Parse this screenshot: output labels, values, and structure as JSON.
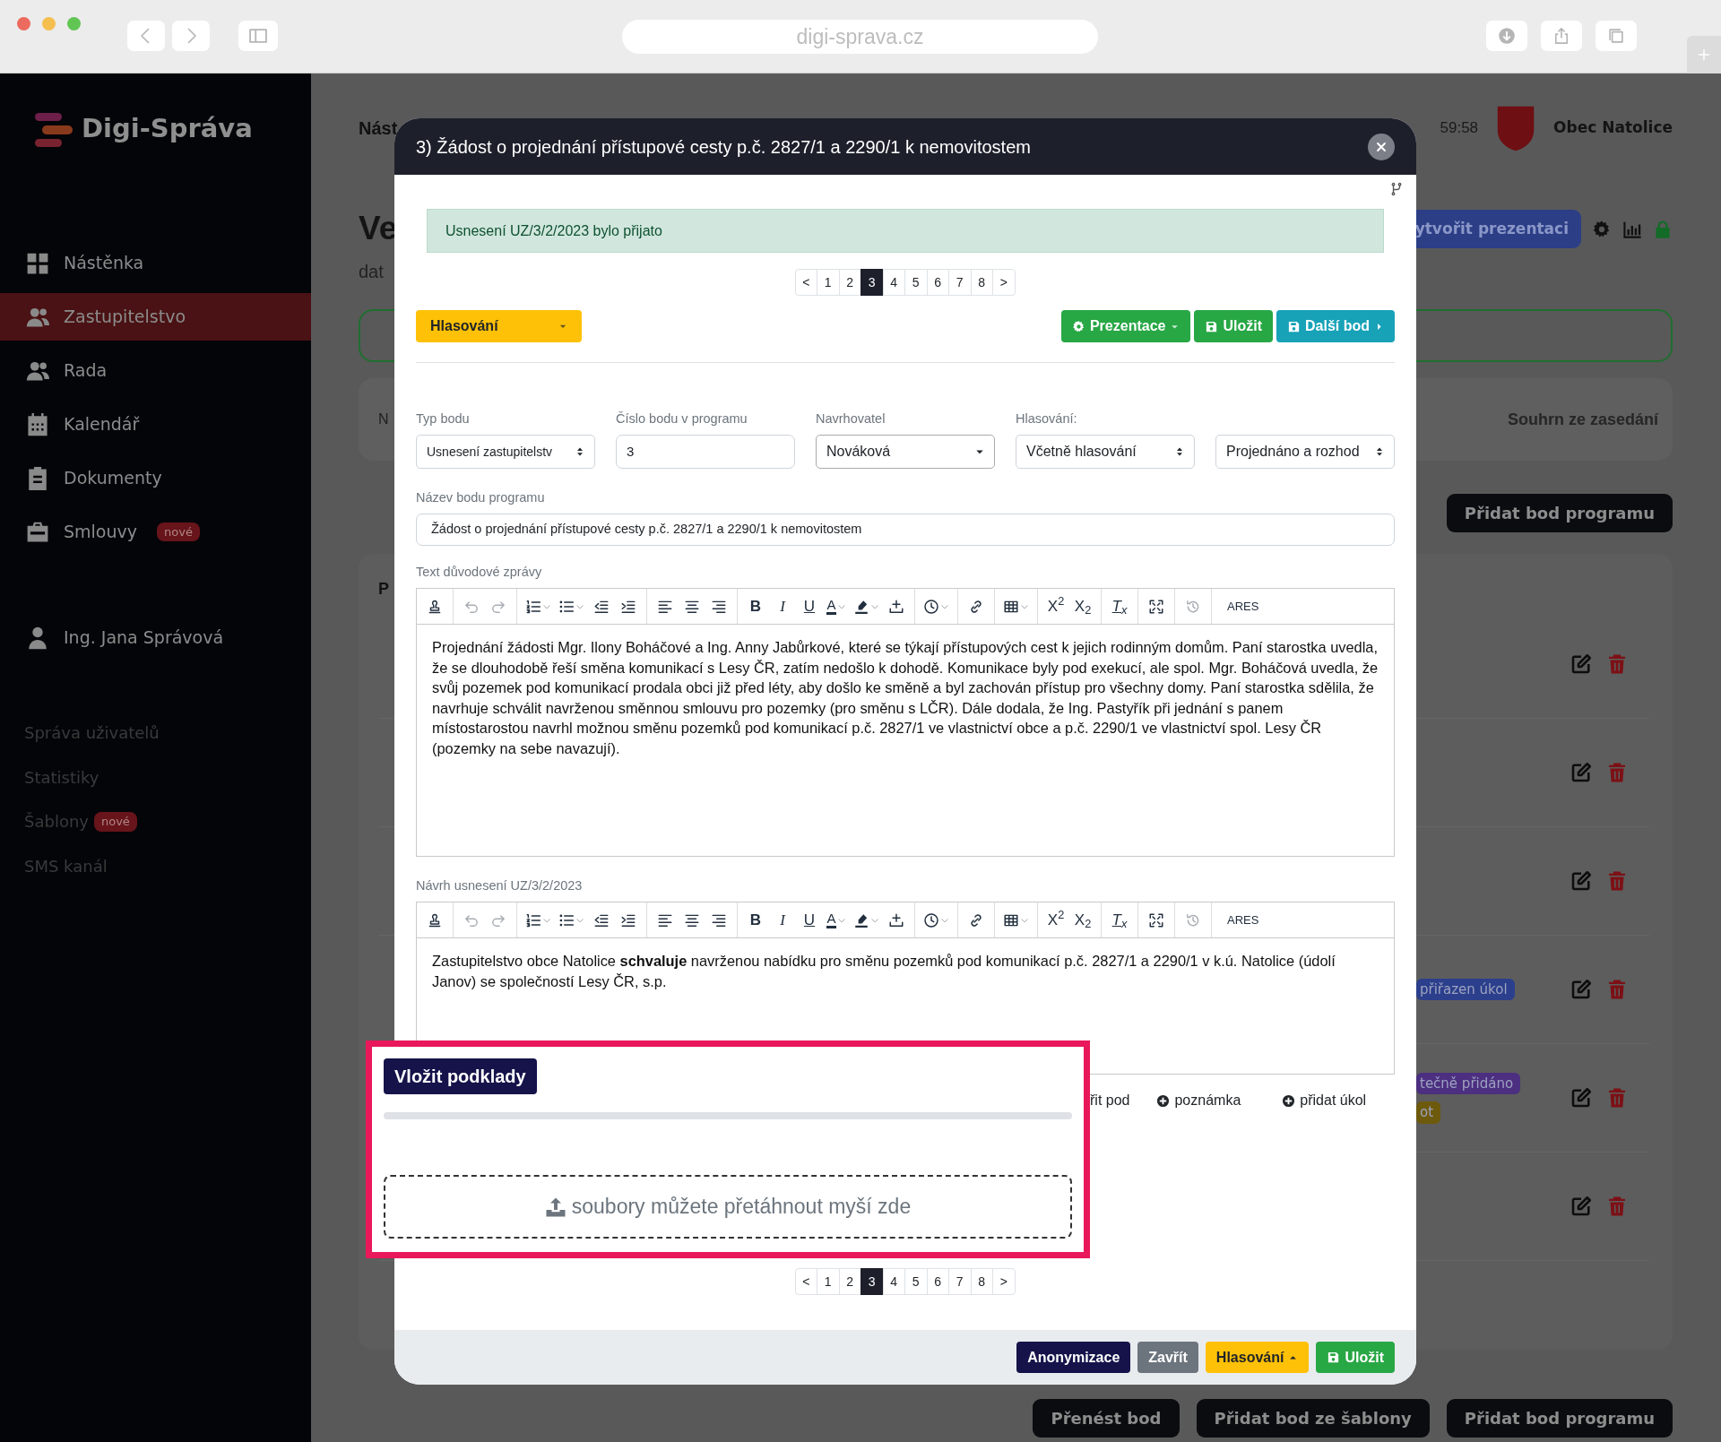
{
  "browser": {
    "url": "digi-sprava.cz"
  },
  "sidebar": {
    "brand": "Digi-Správa",
    "nav": [
      {
        "label": "Nástěnka",
        "kind": "grid",
        "selected": false
      },
      {
        "label": "Zastupitelstvo",
        "kind": "users",
        "selected": true
      },
      {
        "label": "Rada",
        "kind": "users",
        "selected": false
      },
      {
        "label": "Kalendář",
        "kind": "calendar",
        "selected": false
      },
      {
        "label": "Dokumenty",
        "kind": "clipboard",
        "selected": false
      },
      {
        "label": "Smlouvy",
        "kind": "briefcase",
        "selected": false,
        "badge": "nové"
      }
    ],
    "user": "Ing. Jana Správová",
    "admin_links": [
      {
        "label": "Správa uživatelů"
      },
      {
        "label": "Statistiky"
      },
      {
        "label": "Šablony",
        "badge": "nové"
      },
      {
        "label": "SMS kanál"
      }
    ]
  },
  "page": {
    "breadcrumb": "Nást",
    "time": "59:58",
    "municipality": "Obec Natolice",
    "heading": "Ve",
    "subheading": "dat",
    "create_button": "ytvořit prezentaci",
    "summary_left": "N",
    "summary_right": "Souhrn ze zasedání",
    "add_button_top": "Přidat bod programu",
    "list_heading": "P",
    "rows": [
      {},
      {},
      {},
      {
        "badges": [
          {
            "label": "přiřazen úkol",
            "color": "#2b3f8c"
          }
        ]
      },
      {
        "badges": [
          {
            "label": "tečně přidáno",
            "color": "#4c2f80"
          },
          {
            "label": "ot",
            "color": "#6e5a0c"
          }
        ]
      },
      {}
    ],
    "bottom_buttons": [
      "Přenést bod",
      "Přidat bod ze šablony",
      "Přidat bod programu"
    ]
  },
  "modal": {
    "title": "3) Žádost o projednání přístupové cesty p.č. 2827/1 a 2290/1 k nemovitostem",
    "alert": "Usnesení UZ/3/2/2023 bylo přijato",
    "pagination_top": [
      {
        "label": "<",
        "selected": false
      },
      {
        "label": "1",
        "selected": false
      },
      {
        "label": "2",
        "selected": false
      },
      {
        "label": "3",
        "selected": true
      },
      {
        "label": "4",
        "selected": false
      },
      {
        "label": "5",
        "selected": false
      },
      {
        "label": "6",
        "selected": false
      },
      {
        "label": "7",
        "selected": false
      },
      {
        "label": "8",
        "selected": false
      },
      {
        "label": ">",
        "selected": false
      }
    ],
    "voting_dropdown": "Hlasování",
    "actions": [
      {
        "label": "Prezentace"
      },
      {
        "label": "Uložit"
      },
      {
        "label": "Další bod"
      }
    ],
    "fields": [
      {
        "label": "Typ bodu",
        "value": "Usnesení zastupitelstv",
        "kind": "select"
      },
      {
        "label": "Číslo bodu v programu",
        "value": "3",
        "kind": "input"
      },
      {
        "label": "Navrhovatel",
        "value": "Nováková",
        "kind": "dropdown"
      },
      {
        "label": "Hlasování:",
        "value": "Včetně hlasování",
        "kind": "select"
      },
      {
        "value": "Projednáno a rozhod",
        "kind": "select"
      }
    ],
    "name_field": {
      "label": "Název bodu programu",
      "value": "Žádost o projednání přístupové cesty p.č. 2827/1 a 2290/1 k nemovitostem"
    },
    "editors": [
      {
        "label": "Text důvodové zprávy",
        "text": "Projednání žádosti Mgr. Ilony Boháčové a Ing. Anny Jabůrkové, které se týkají přístupových cest k jejich rodinným domům. Paní starostka uvedla, že se dlouhodobě řeší směna komunikací s Lesy ČR, zatím nedošlo k dohodě. Komunikace byly pod exekucí, ale spol. Mgr. Boháčová uvedla, že svůj pozemek pod komunikací prodala obci již před léty, aby došlo ke směně a byl zachován přístup pro všechny domy. Paní starostka sdělila, že navrhuje schválit navrženou směnnou smlouvu pro pozemky (pro směnu s LČR). Dále dodala, že Ing. Pastyřík při jednání s panem místostarostou navrhl možnou směnu pozemků pod komunikací p.č. 2827/1 ve vlastnictví obce a p.č. 2290/1 ve vlastnictví spol. Lesy ČR (pozemky na sebe navazují).",
        "toolbar": [
          [
            {
              "kind": "stamp"
            }
          ],
          [
            {
              "kind": "undo",
              "disabled": true
            },
            {
              "kind": "redo",
              "disabled": true
            }
          ],
          [
            {
              "kind": "ordered-list",
              "dropdown": true
            },
            {
              "kind": "bullet-list",
              "dropdown": true
            },
            {
              "kind": "outdent"
            },
            {
              "kind": "indent"
            }
          ],
          [
            {
              "kind": "align-left"
            },
            {
              "kind": "align-center"
            },
            {
              "kind": "align-right"
            }
          ],
          [
            {
              "kind": "bold",
              "label": "B"
            },
            {
              "kind": "italic",
              "label": "I"
            },
            {
              "kind": "underline",
              "label": "U"
            },
            {
              "kind": "text-color",
              "label": "A",
              "dropdown": true
            },
            {
              "kind": "highlight",
              "dropdown": true
            },
            {
              "kind": "insert"
            }
          ],
          [
            {
              "kind": "clock",
              "dropdown": true
            }
          ],
          [
            {
              "kind": "link"
            }
          ],
          [
            {
              "kind": "table",
              "dropdown": true
            }
          ],
          [
            {
              "kind": "superscript",
              "label": "X$^{2}$"
            },
            {
              "kind": "subscript",
              "label": "X$_{2}$"
            }
          ],
          [
            {
              "kind": "clear-format",
              "label": "T$_{x}$"
            }
          ],
          [
            {
              "kind": "fullscreen"
            }
          ],
          [
            {
              "kind": "history",
              "disabled": true
            }
          ],
          [
            {
              "kind": "plain",
              "label": "ARES"
            }
          ]
        ]
      },
      {
        "label": "Návrh usnesení UZ/3/2/2023",
        "text": "Zastupitelstvo obce Natolice **schvaluje** navrženou nabídku pro směnu pozemků pod komunikací p.č. 2827/1 a 2290/1 v k.ú. Natolice (údolí Janov) se společností Lesy ČR, s.p.",
        "toolbar": [
          [
            {
              "kind": "stamp"
            }
          ],
          [
            {
              "kind": "undo",
              "disabled": true
            },
            {
              "kind": "redo",
              "disabled": true
            }
          ],
          [
            {
              "kind": "ordered-list",
              "dropdown": true
            },
            {
              "kind": "bullet-list",
              "dropdown": true
            },
            {
              "kind": "outdent"
            },
            {
              "kind": "indent"
            }
          ],
          [
            {
              "kind": "align-left"
            },
            {
              "kind": "align-center"
            },
            {
              "kind": "align-right"
            }
          ],
          [
            {
              "kind": "bold",
              "label": "B"
            },
            {
              "kind": "italic",
              "label": "I"
            },
            {
              "kind": "underline",
              "label": "U"
            },
            {
              "kind": "text-color",
              "label": "A",
              "dropdown": true
            },
            {
              "kind": "highlight",
              "dropdown": true
            },
            {
              "kind": "insert"
            }
          ],
          [
            {
              "kind": "clock",
              "dropdown": true
            }
          ],
          [
            {
              "kind": "link"
            }
          ],
          [
            {
              "kind": "table",
              "dropdown": true
            }
          ],
          [
            {
              "kind": "superscript",
              "label": "X$^{2}$"
            },
            {
              "kind": "subscript",
              "label": "X$_{2}$"
            }
          ],
          [
            {
              "kind": "clear-format",
              "label": "T$_{x}$"
            }
          ],
          [
            {
              "kind": "fullscreen"
            }
          ],
          [
            {
              "kind": "history",
              "disabled": true
            }
          ],
          [
            {
              "kind": "plain",
              "label": "ARES"
            }
          ]
        ]
      }
    ],
    "links": [
      {
        "label": "řit pod"
      },
      {
        "label": "poznámka"
      },
      {
        "label": "přidat úkol"
      }
    ],
    "upload": {
      "button": "Vložit podklady",
      "dropzone": "soubory můžete přetáhnout myší zde"
    },
    "pagination_bottom": [
      {
        "label": "<",
        "selected": false
      },
      {
        "label": "1",
        "selected": false
      },
      {
        "label": "2",
        "selected": false
      },
      {
        "label": "3",
        "selected": true
      },
      {
        "label": "4",
        "selected": false
      },
      {
        "label": "5",
        "selected": false
      },
      {
        "label": "6",
        "selected": false
      },
      {
        "label": "7",
        "selected": false
      },
      {
        "label": "8",
        "selected": false
      },
      {
        "label": ">",
        "selected": false
      }
    ],
    "footer": [
      {
        "label": "Anonymizace"
      },
      {
        "label": "Zavřít"
      },
      {
        "label": "Hlasování"
      },
      {
        "label": "Uložit"
      }
    ]
  }
}
